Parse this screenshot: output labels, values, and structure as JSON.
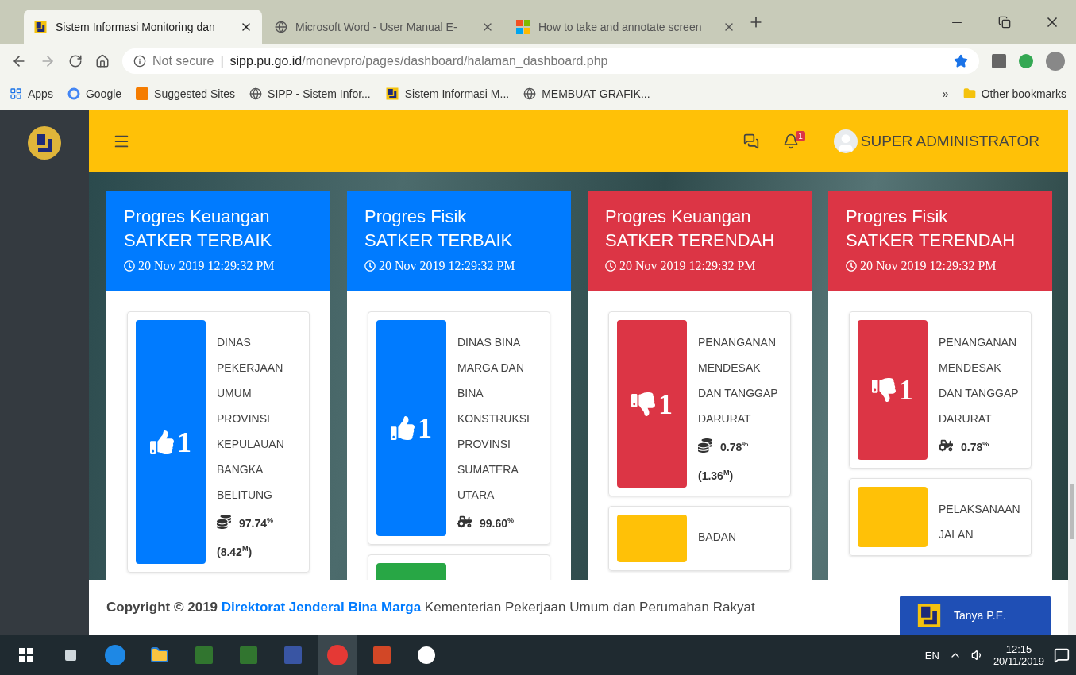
{
  "browser": {
    "tabs": [
      {
        "title": "Sistem Informasi Monitoring dan",
        "kind": "pu",
        "selected": true
      },
      {
        "title": "Microsoft Word - User Manual E-",
        "kind": "globe",
        "selected": false
      },
      {
        "title": "How to take and annotate screen",
        "kind": "ms",
        "selected": false
      }
    ],
    "security": "Not secure",
    "separator": "|",
    "url_host": "sipp.pu.go.id",
    "url_path": "/monevpro/pages/dashboard/halaman_dashboard.php",
    "bookmarks": [
      {
        "label": "Apps",
        "kind": "apps"
      },
      {
        "label": "Google",
        "kind": "google"
      },
      {
        "label": "Suggested Sites",
        "kind": "suggested"
      },
      {
        "label": "SIPP - Sistem Infor...",
        "kind": "globe"
      },
      {
        "label": "Sistem Informasi M...",
        "kind": "pu"
      },
      {
        "label": "MEMBUAT GRAFIK...",
        "kind": "globe"
      }
    ],
    "overflow": "»",
    "other_bookmarks": "Other bookmarks"
  },
  "header": {
    "notification_count": "1",
    "user": "SUPER ADMINISTRATOR"
  },
  "cards": [
    {
      "kind": "best",
      "color": "#007bff",
      "title": "Progres Keuangan",
      "subtitle": "SATKER TERBAIK",
      "timestamp": "20 Nov 2019 12:29:32 PM",
      "entries": [
        {
          "color": "#007bff",
          "rank": "1",
          "name": "DINAS PEKERJAAN UMUM PROVINSI KEPULAUAN BANGKA BELITUNG",
          "kind": "finance",
          "value": "97.74$^{%}$",
          "amount": "(8.42$^{M}$)"
        }
      ]
    },
    {
      "kind": "best",
      "color": "#007bff",
      "title": "Progres Fisik",
      "subtitle": "SATKER TERBAIK",
      "timestamp": "20 Nov 2019 12:29:32 PM",
      "entries": [
        {
          "color": "#007bff",
          "rank": "1",
          "name": "DINAS BINA MARGA DAN BINA KONSTRUKSI PROVINSI SUMATERA UTARA",
          "kind": "physical",
          "value": "99.60$^{%}$"
        },
        {
          "color": "#28a745"
        }
      ]
    },
    {
      "kind": "worst",
      "color": "#dc3545",
      "title": "Progres Keuangan",
      "subtitle": "SATKER TERENDAH",
      "timestamp": "20 Nov 2019 12:29:32 PM",
      "entries": [
        {
          "color": "#dc3545",
          "rank": "1",
          "name": "PENANGANAN MENDESAK DAN TANGGAP DARURAT",
          "kind": "finance",
          "value": "0.78$^{%}$",
          "amount": "(1.36$^{M}$)"
        },
        {
          "color": "#ffc107",
          "name": "BADAN"
        }
      ]
    },
    {
      "kind": "worst",
      "color": "#dc3545",
      "title": "Progres Fisik",
      "subtitle": "SATKER TERENDAH",
      "timestamp": "20 Nov 2019 12:29:32 PM",
      "entries": [
        {
          "color": "#dc3545",
          "rank": "1",
          "name": "PENANGANAN MENDESAK DAN TANGGAP DARURAT",
          "kind": "physical",
          "value": "0.78$^{%}$"
        },
        {
          "color": "#ffc107",
          "name": "PELAKSANAAN JALAN"
        }
      ]
    }
  ],
  "footer": {
    "copyright": "Copyright © 2019",
    "link": "Direktorat Jenderal Bina Marga",
    "rest": "Kementerian Pekerjaan Umum dan Perumahan Rakyat",
    "chat_button": "Tanya P.E."
  },
  "taskbar": {
    "language": "EN",
    "time": "12:15",
    "date": "20/11/2019"
  }
}
